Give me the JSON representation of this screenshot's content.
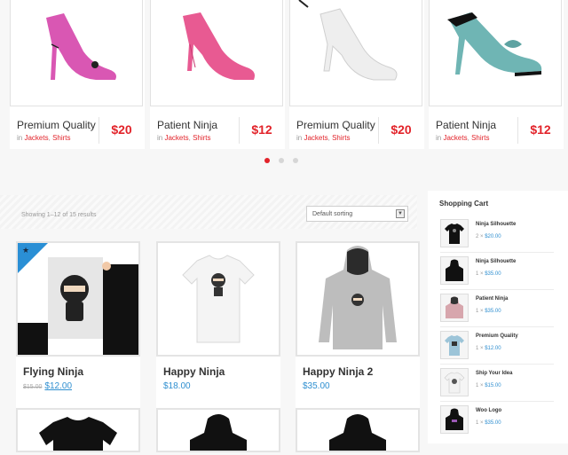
{
  "carousel": {
    "products": [
      {
        "name": "Premium Quality",
        "in": "in",
        "cat1": "Jackets",
        "sep": ",",
        "cat2": "Shirts",
        "price": "$20",
        "shoe": "#d957b3"
      },
      {
        "name": "Patient Ninja",
        "in": "in",
        "cat1": "Jackets",
        "sep": ",",
        "cat2": "Shirts",
        "price": "$12",
        "shoe": "#e85a92"
      },
      {
        "name": "Premium Quality",
        "in": "in",
        "cat1": "Jackets",
        "sep": ",",
        "cat2": "Shirts",
        "price": "$20",
        "shoe": "#f2f2f2"
      },
      {
        "name": "Patient Ninja",
        "in": "in",
        "cat1": "Jackets",
        "sep": ",",
        "cat2": "Shirts",
        "price": "$12",
        "shoe": "#6fb5b4"
      }
    ]
  },
  "shop": {
    "result_count": "Showing 1–12 of 15 results",
    "sorting": "Default sorting",
    "sort_arrow": "▼",
    "products": [
      {
        "name": "Flying Ninja",
        "old_price": "$15.00",
        "price": "$12.00",
        "sale": true,
        "star": "★"
      },
      {
        "name": "Happy Ninja",
        "price": "$18.00"
      },
      {
        "name": "Happy Ninja 2",
        "price": "$35.00"
      }
    ]
  },
  "cart": {
    "title": "Shopping Cart",
    "items": [
      {
        "name": "Ninja Silhouette",
        "qty": "2 ×",
        "price": "$20.00",
        "kind": "tee-black"
      },
      {
        "name": "Ninja Silhouette",
        "qty": "1 ×",
        "price": "$35.00",
        "kind": "hoodie-black"
      },
      {
        "name": "Patient Ninja",
        "qty": "1 ×",
        "price": "$35.00",
        "kind": "hoodie-pink"
      },
      {
        "name": "Premium Quality",
        "qty": "1 ×",
        "price": "$12.00",
        "kind": "tee-teal"
      },
      {
        "name": "Ship Your Idea",
        "qty": "1 ×",
        "price": "$15.00",
        "kind": "tee-white"
      },
      {
        "name": "Woo Logo",
        "qty": "1 ×",
        "price": "$35.00",
        "kind": "hoodie-black"
      }
    ]
  },
  "colors": {
    "accent": "#e2232a",
    "link": "#2f8fd0",
    "sale": "#2a8fd5"
  }
}
